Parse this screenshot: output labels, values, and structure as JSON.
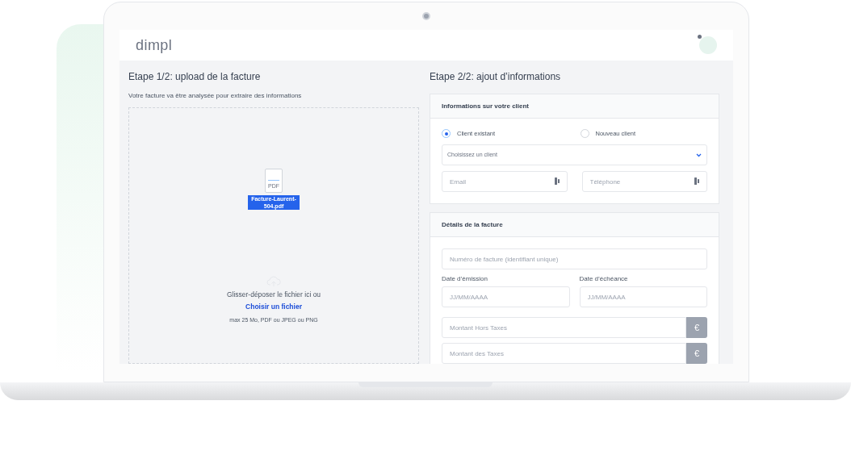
{
  "app": {
    "logo": "dimpl"
  },
  "step1": {
    "title": "Etape 1/2: upload de la facture",
    "subtitle": "Votre facture va être analysée pour extraire des informations",
    "file": {
      "icon_label": "PDF",
      "name": "Facture-Laurent-504.pdf",
      "selected": true
    },
    "dropzone": {
      "prompt": "Glisser-déposer le fichier ici ou",
      "link": "Choisir un fichier",
      "hint": "max 25 Mo, PDF ou JPEG ou PNG"
    }
  },
  "step2": {
    "title": "Etape 2/2: ajout d’informations",
    "client_card": {
      "title": "Informations sur votre client",
      "radios": [
        {
          "label": "Client existant",
          "selected": true
        },
        {
          "label": "Nouveau client",
          "selected": false
        }
      ],
      "select": {
        "placeholder": "Choisissez un client"
      },
      "fields": [
        {
          "placeholder": "Email"
        },
        {
          "placeholder": "Téléphone"
        }
      ]
    },
    "invoice_card": {
      "title": "Détails de la facture",
      "number": {
        "placeholder": "Numéro de facture (identifiant unique)"
      },
      "dates": [
        {
          "label": "Date d’émission",
          "placeholder": "JJ/MM/AAAA"
        },
        {
          "label": "Date d’échéance",
          "placeholder": "JJ/MM/AAAA"
        }
      ],
      "amounts": [
        {
          "placeholder": "Montant Hors Taxes",
          "unit": "€"
        },
        {
          "placeholder": "Montant des Taxes",
          "unit": "€"
        }
      ]
    }
  }
}
